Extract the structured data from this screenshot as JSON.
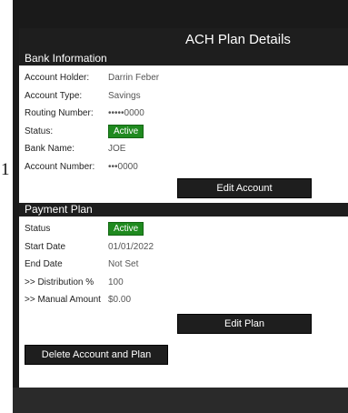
{
  "side_number": "1",
  "modal": {
    "title": "ACH Plan Details"
  },
  "bank": {
    "header": "Bank Information",
    "rows": [
      {
        "label": "Account Holder:",
        "value": "Darrin Feber"
      },
      {
        "label": "Account Type:",
        "value": "Savings"
      },
      {
        "label": "Routing Number:",
        "value": "•••••0000"
      },
      {
        "label": "Status:",
        "value": "Active"
      },
      {
        "label": "Bank Name:",
        "value": "JOE"
      },
      {
        "label": "Account Number:",
        "value": "•••0000"
      }
    ],
    "edit_label": "Edit Account"
  },
  "plan": {
    "header": "Payment Plan",
    "rows": [
      {
        "label": "Status",
        "value": "Active"
      },
      {
        "label": "Start Date",
        "value": "01/01/2022"
      },
      {
        "label": "End Date",
        "value": "Not Set"
      },
      {
        "label": ">> Distribution %",
        "value": "100"
      },
      {
        "label": ">> Manual Amount",
        "value": "$0.00"
      }
    ],
    "edit_label": "Edit Plan"
  },
  "delete_label": "Delete Account and Plan",
  "colors": {
    "active": "#1f8a1f",
    "header": "#1e1e1e"
  }
}
